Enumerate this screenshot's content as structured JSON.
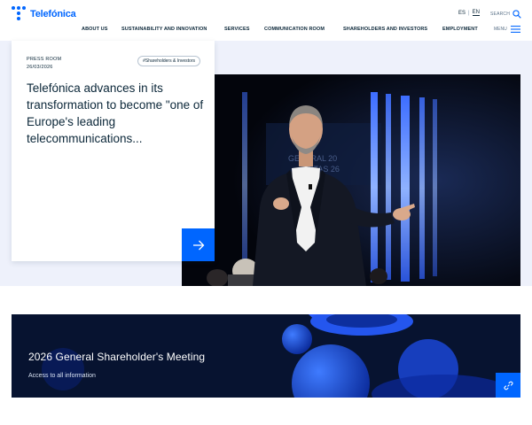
{
  "brand": {
    "name": "Telefónica",
    "color": "#0066ff"
  },
  "header": {
    "languages": [
      "ES",
      "EN"
    ],
    "active_language": "EN",
    "search_label": "SEARCH",
    "menu_label": "MENU",
    "nav": [
      "ABOUT US",
      "SUSTAINABILITY AND INNOVATION",
      "SERVICES",
      "COMMUNICATION ROOM",
      "SHAREHOLDERS AND INVESTORS",
      "EMPLOYMENT"
    ]
  },
  "hero": {
    "kicker": "PRESS ROOM",
    "date": "26/03/2026",
    "tag": "#Shareholders & Investors",
    "title": "Telefónica advances in its transformation to become \"one of Europe's leading telecommunications...",
    "arrow_icon": "arrow-right-icon",
    "photo_text": [
      "GENERAL 20",
      "ISTAS 26"
    ]
  },
  "banner": {
    "title": "2026 General Shareholder's Meeting",
    "subtitle": "Access to all information",
    "link_icon": "link-icon"
  }
}
